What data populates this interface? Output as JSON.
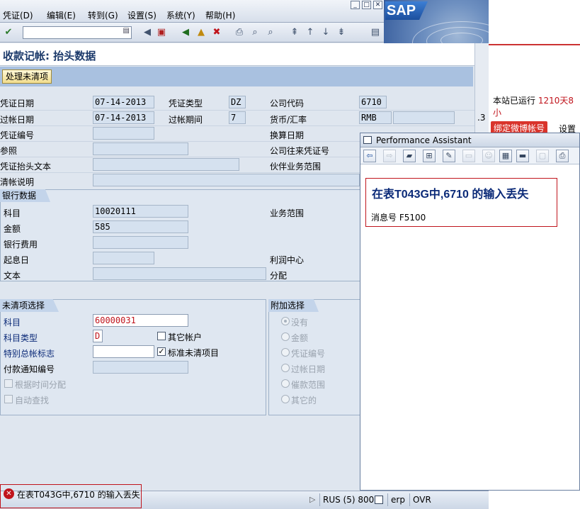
{
  "menu": {
    "items": [
      "凭证(D)",
      "编辑(E)",
      "转到(G)",
      "设置(S)",
      "系统(Y)",
      "帮助(H)"
    ]
  },
  "window_buttons": {
    "minimize": "_",
    "restore": "□",
    "close": "✕"
  },
  "logo_text": "SAP",
  "page": {
    "title": "收款记帐: 抬头数据",
    "open_items_button": "处理未清项"
  },
  "header": {
    "doc_date_label": "凭证日期",
    "doc_date": "07-14-2013",
    "doc_type_label": "凭证类型",
    "doc_type": "DZ",
    "company_code_label": "公司代码",
    "company_code": "6710",
    "posting_date_label": "过帐日期",
    "posting_date": "07-14-2013",
    "period_label": "过帐期间",
    "period": "7",
    "currency_label": "货币/汇率",
    "currency": "RMB",
    "doc_number_label": "凭证编号",
    "translation_date_label": "换算日期",
    "reference_label": "参照",
    "cross_cc_label": "公司往来凭证号",
    "header_text_label": "凭证抬头文本",
    "partner_ba_label": "伙伴业务范围",
    "clearing_text_label": "清帐说明",
    "stray_value": ".3"
  },
  "bank": {
    "group_title": "银行数据",
    "account_label": "科目",
    "account": "10020111",
    "business_area_label": "业务范围",
    "amount_label": "金额",
    "amount": "585",
    "bank_charges_label": "银行费用",
    "value_date_label": "起息日",
    "profit_center_label": "利润中心",
    "text_label": "文本",
    "assignment_label": "分配"
  },
  "open_item": {
    "group_title": "未清项选择",
    "account_label": "科目",
    "account": "60000031",
    "account_type_label": "科目类型",
    "account_type": "D",
    "other_accounts_label": "其它帐户",
    "special_gl_label": "特别总帐标志",
    "standard_oi_label": "标准未清项目",
    "payment_advice_label": "付款通知编号",
    "distribute_by_age_label": "根据时间分配",
    "auto_search_label": "自动查找"
  },
  "additional": {
    "group_title": "附加选择",
    "options": [
      "没有",
      "金额",
      "凭证编号",
      "过帐日期",
      "催款范围",
      "其它的"
    ]
  },
  "right_panel": {
    "runtime_text_prefix": "本站已运行",
    "runtime_text_value": "1210天8小",
    "weibo_button": "绑定微博帐号",
    "settings": "设置"
  },
  "assistant": {
    "title": "Performance Assistant",
    "message": "在表T043G中,6710  的输入丢失",
    "message_number": "消息号  F5100"
  },
  "status": {
    "message": "在表T043G中,6710  的输入丢失",
    "language": "RUS (5) 800",
    "server": "erp",
    "mode": "OVR"
  },
  "colors": {
    "error": "#c0141c",
    "label_blue": "#0b2a78",
    "group_header": "#c3d4ea"
  }
}
